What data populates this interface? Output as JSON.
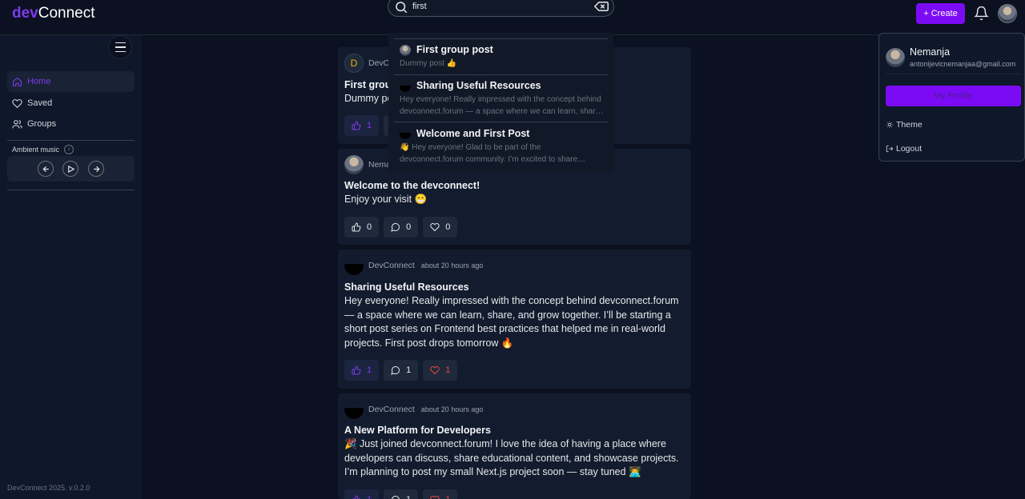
{
  "header": {
    "logo_accent": "dev",
    "logo_rest": "Connect",
    "search_value": "first",
    "create_label": "+ Create"
  },
  "sidebar": {
    "items": [
      {
        "label": "Home",
        "icon": "home-icon"
      },
      {
        "label": "Saved",
        "icon": "heart-icon"
      },
      {
        "label": "Groups",
        "icon": "users-icon"
      }
    ],
    "music_label": "Ambient music",
    "music_badge": "♪",
    "version": "DevConnect 2025. v.0.2.0"
  },
  "posts": [
    {
      "author": "DevC",
      "avatar": "D",
      "title": "First grou",
      "body": "Dummy po",
      "likes": "1",
      "comments": "",
      "hearts": ""
    },
    {
      "author": "Nema",
      "time": "",
      "title": "Welcome to the devconnect!",
      "body": "Enjoy your visit 😁",
      "likes": "0",
      "comments": "0",
      "hearts": "0"
    },
    {
      "author": "DevConnect",
      "time": "about 20 hours ago",
      "title": "Sharing Useful Resources",
      "body": "Hey everyone! Really impressed with the concept behind devconnect.forum — a space where we can learn, share, and grow together. I’ll be starting a short post series on Frontend best practices that helped me in real-world projects. First post drops tomorrow 🔥",
      "likes": "1",
      "comments": "1",
      "hearts": "1"
    },
    {
      "author": "DevConnect",
      "time": "about 20 hours ago",
      "title": "A New Platform for Developers",
      "body": "🎉 Just joined devconnect.forum! I love the idea of having a place where developers can discuss, share educational content, and showcase projects. I’m planning to post my small Next.js project soon — stay tuned 👨‍💻",
      "likes": "1",
      "comments": "1",
      "hearts": "1"
    }
  ],
  "search_results": [
    {
      "title": "First group post",
      "snippet": "Dummy post 👍"
    },
    {
      "title": "Sharing Useful Resources",
      "snippet": "Hey everyone! Really impressed with the concept behind devconnect.forum — a space where we can learn, shar…"
    },
    {
      "title": "Welcome and First Post",
      "snippet": "👋 Hey everyone! Glad to be part of the devconnect.forum community. I’m excited to share…"
    }
  ],
  "profile_menu": {
    "name": "Nemanja",
    "email": "antonijevicnemanjaa@gmail.com",
    "profile_button": "My Profile",
    "theme_label": "Theme",
    "logout_label": "Logout"
  },
  "colors": {
    "accent": "#7c0bf5",
    "background": "#0b1120",
    "card": "#131c2e"
  }
}
